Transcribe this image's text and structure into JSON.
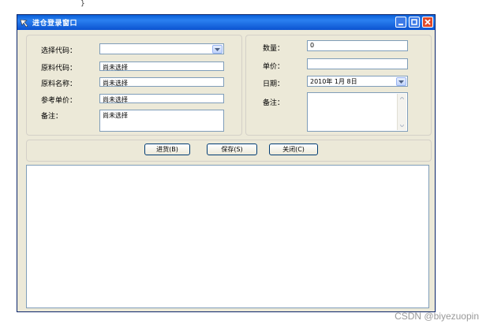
{
  "top_glyph": "}",
  "window": {
    "title": "进仓登录窗口",
    "icon": "app-arrow-icon",
    "controls": [
      "minimize-icon",
      "maximize-icon",
      "close-icon"
    ]
  },
  "form_left": {
    "select_code_label": "选择代码：",
    "select_code_value": "",
    "material_code_label": "原料代码：",
    "material_code_value": "尚未选择",
    "material_name_label": "原料名称：",
    "material_name_value": "尚未选择",
    "ref_price_label": "参考单价：",
    "ref_price_value": "尚未选择",
    "remark_label": "备注：",
    "remark_value": "尚未选择"
  },
  "form_right": {
    "quantity_label": "数量：",
    "quantity_value": "0",
    "unit_price_label": "单价：",
    "unit_price_value": "",
    "date_label": "日期：",
    "date_value": "2010年 1月 8日",
    "remark_label": "备注：",
    "remark_value": ""
  },
  "buttons": {
    "stock_in": "进货(B)",
    "save": "保存(S)",
    "close": "关闭(C)"
  },
  "watermark": "CSDN @biyezuopin",
  "colors": {
    "titlebar": "#0a5fd8",
    "window_bg": "#ece9d8",
    "field_border": "#7f9db9",
    "close_red": "#e04a2a"
  }
}
